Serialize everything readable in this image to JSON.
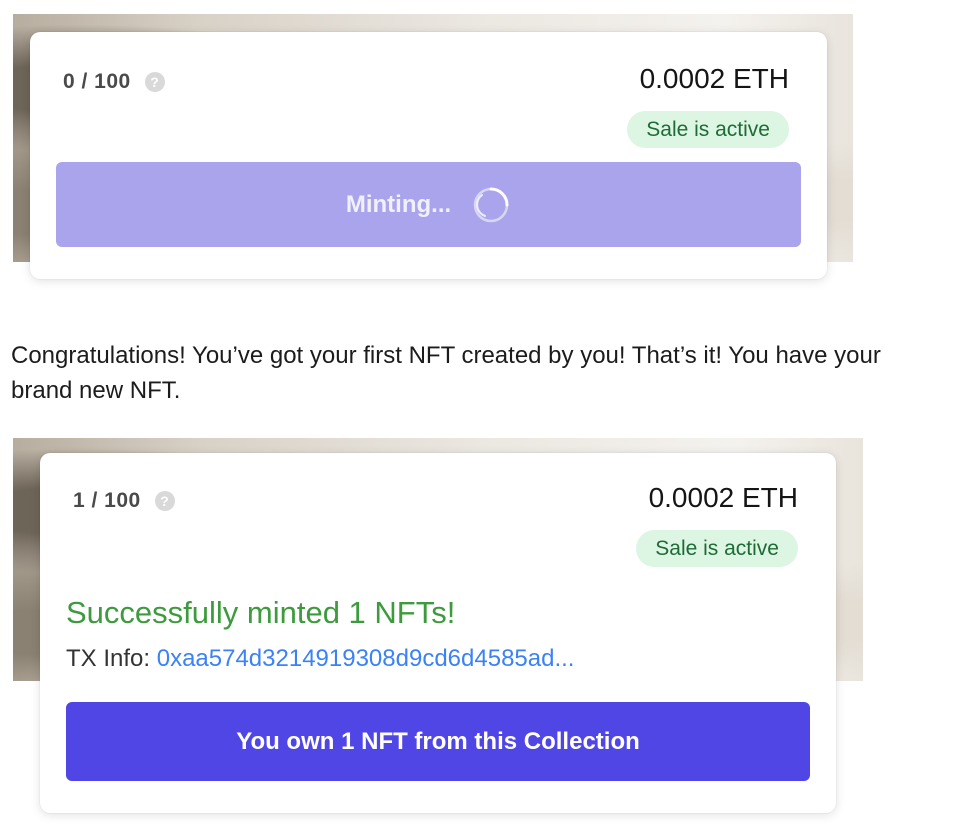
{
  "card_before": {
    "counter": "0 / 100",
    "help_icon": "?",
    "price": "0.0002 ETH",
    "status_badge": "Sale is active",
    "mint_button_label": "Minting..."
  },
  "paragraph": "Congratulations! You’ve got your first NFT created by you! That’s it! You have your brand new NFT.",
  "card_after": {
    "counter": "1 / 100",
    "help_icon": "?",
    "price": "0.0002 ETH",
    "status_badge": "Sale is active",
    "success_message": "Successfully minted 1 NFTs!",
    "tx_label": "TX Info:",
    "tx_hash": "0xaa574d3214919308d9cd6d4585ad...",
    "own_button_label": "You own 1 NFT from this Collection"
  },
  "colors": {
    "accent": "#4f46e5",
    "accent_disabled": "#a9a4ec",
    "success": "#3d9b3d",
    "badge_bg": "#dcf6e3",
    "link": "#3b82f6"
  },
  "icons": {
    "help": "question-circle-icon",
    "spinner": "loading-spinner-icon"
  }
}
